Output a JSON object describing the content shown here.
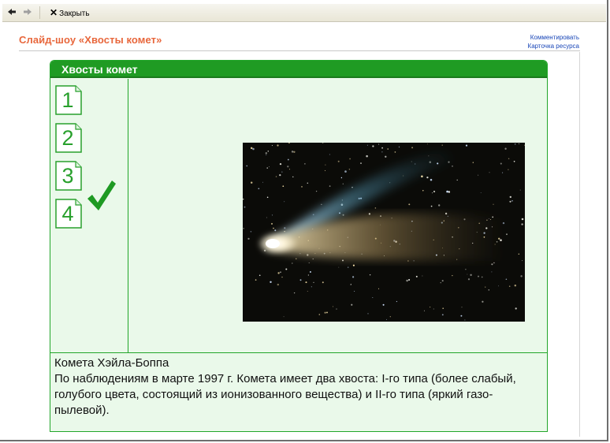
{
  "toolbar": {
    "back_label": "",
    "forward_label": "",
    "close_label": "Закрыть"
  },
  "header": {
    "title": "Слайд-шоу «Хвосты комет»",
    "links": [
      "Комментировать",
      "Карточка ресурса"
    ]
  },
  "panel": {
    "title": "Хвосты комет",
    "slides": [
      "1",
      "2",
      "3",
      "4"
    ],
    "current_slide": "3",
    "caption_title": "Комета Хэйла-Боппа",
    "caption_text": "По наблюдениям в марте 1997 г. Комета имеет два хвоста: I-го типа (более слабый, голубого цвета, состоящий из ионизованного вещества) и II-го типа (яркий газо-пылевой)."
  },
  "colors": {
    "accent_green": "#1f9b23",
    "title_orange": "#e8673c",
    "link_blue": "#1a47b8",
    "panel_bg": "#eaf9ea"
  }
}
